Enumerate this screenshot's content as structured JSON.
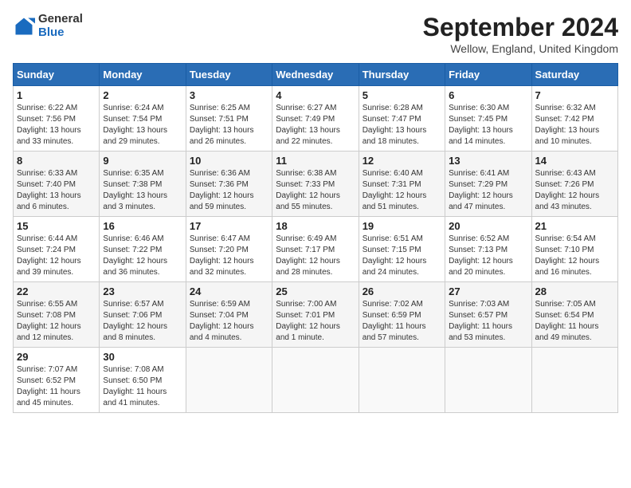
{
  "logo": {
    "general": "General",
    "blue": "Blue"
  },
  "title": "September 2024",
  "subtitle": "Wellow, England, United Kingdom",
  "headers": [
    "Sunday",
    "Monday",
    "Tuesday",
    "Wednesday",
    "Thursday",
    "Friday",
    "Saturday"
  ],
  "weeks": [
    [
      {
        "day": "1",
        "info": "Sunrise: 6:22 AM\nSunset: 7:56 PM\nDaylight: 13 hours\nand 33 minutes."
      },
      {
        "day": "2",
        "info": "Sunrise: 6:24 AM\nSunset: 7:54 PM\nDaylight: 13 hours\nand 29 minutes."
      },
      {
        "day": "3",
        "info": "Sunrise: 6:25 AM\nSunset: 7:51 PM\nDaylight: 13 hours\nand 26 minutes."
      },
      {
        "day": "4",
        "info": "Sunrise: 6:27 AM\nSunset: 7:49 PM\nDaylight: 13 hours\nand 22 minutes."
      },
      {
        "day": "5",
        "info": "Sunrise: 6:28 AM\nSunset: 7:47 PM\nDaylight: 13 hours\nand 18 minutes."
      },
      {
        "day": "6",
        "info": "Sunrise: 6:30 AM\nSunset: 7:45 PM\nDaylight: 13 hours\nand 14 minutes."
      },
      {
        "day": "7",
        "info": "Sunrise: 6:32 AM\nSunset: 7:42 PM\nDaylight: 13 hours\nand 10 minutes."
      }
    ],
    [
      {
        "day": "8",
        "info": "Sunrise: 6:33 AM\nSunset: 7:40 PM\nDaylight: 13 hours\nand 6 minutes."
      },
      {
        "day": "9",
        "info": "Sunrise: 6:35 AM\nSunset: 7:38 PM\nDaylight: 13 hours\nand 3 minutes."
      },
      {
        "day": "10",
        "info": "Sunrise: 6:36 AM\nSunset: 7:36 PM\nDaylight: 12 hours\nand 59 minutes."
      },
      {
        "day": "11",
        "info": "Sunrise: 6:38 AM\nSunset: 7:33 PM\nDaylight: 12 hours\nand 55 minutes."
      },
      {
        "day": "12",
        "info": "Sunrise: 6:40 AM\nSunset: 7:31 PM\nDaylight: 12 hours\nand 51 minutes."
      },
      {
        "day": "13",
        "info": "Sunrise: 6:41 AM\nSunset: 7:29 PM\nDaylight: 12 hours\nand 47 minutes."
      },
      {
        "day": "14",
        "info": "Sunrise: 6:43 AM\nSunset: 7:26 PM\nDaylight: 12 hours\nand 43 minutes."
      }
    ],
    [
      {
        "day": "15",
        "info": "Sunrise: 6:44 AM\nSunset: 7:24 PM\nDaylight: 12 hours\nand 39 minutes."
      },
      {
        "day": "16",
        "info": "Sunrise: 6:46 AM\nSunset: 7:22 PM\nDaylight: 12 hours\nand 36 minutes."
      },
      {
        "day": "17",
        "info": "Sunrise: 6:47 AM\nSunset: 7:20 PM\nDaylight: 12 hours\nand 32 minutes."
      },
      {
        "day": "18",
        "info": "Sunrise: 6:49 AM\nSunset: 7:17 PM\nDaylight: 12 hours\nand 28 minutes."
      },
      {
        "day": "19",
        "info": "Sunrise: 6:51 AM\nSunset: 7:15 PM\nDaylight: 12 hours\nand 24 minutes."
      },
      {
        "day": "20",
        "info": "Sunrise: 6:52 AM\nSunset: 7:13 PM\nDaylight: 12 hours\nand 20 minutes."
      },
      {
        "day": "21",
        "info": "Sunrise: 6:54 AM\nSunset: 7:10 PM\nDaylight: 12 hours\nand 16 minutes."
      }
    ],
    [
      {
        "day": "22",
        "info": "Sunrise: 6:55 AM\nSunset: 7:08 PM\nDaylight: 12 hours\nand 12 minutes."
      },
      {
        "day": "23",
        "info": "Sunrise: 6:57 AM\nSunset: 7:06 PM\nDaylight: 12 hours\nand 8 minutes."
      },
      {
        "day": "24",
        "info": "Sunrise: 6:59 AM\nSunset: 7:04 PM\nDaylight: 12 hours\nand 4 minutes."
      },
      {
        "day": "25",
        "info": "Sunrise: 7:00 AM\nSunset: 7:01 PM\nDaylight: 12 hours\nand 1 minute."
      },
      {
        "day": "26",
        "info": "Sunrise: 7:02 AM\nSunset: 6:59 PM\nDaylight: 11 hours\nand 57 minutes."
      },
      {
        "day": "27",
        "info": "Sunrise: 7:03 AM\nSunset: 6:57 PM\nDaylight: 11 hours\nand 53 minutes."
      },
      {
        "day": "28",
        "info": "Sunrise: 7:05 AM\nSunset: 6:54 PM\nDaylight: 11 hours\nand 49 minutes."
      }
    ],
    [
      {
        "day": "29",
        "info": "Sunrise: 7:07 AM\nSunset: 6:52 PM\nDaylight: 11 hours\nand 45 minutes."
      },
      {
        "day": "30",
        "info": "Sunrise: 7:08 AM\nSunset: 6:50 PM\nDaylight: 11 hours\nand 41 minutes."
      },
      {
        "day": "",
        "info": ""
      },
      {
        "day": "",
        "info": ""
      },
      {
        "day": "",
        "info": ""
      },
      {
        "day": "",
        "info": ""
      },
      {
        "day": "",
        "info": ""
      }
    ]
  ]
}
